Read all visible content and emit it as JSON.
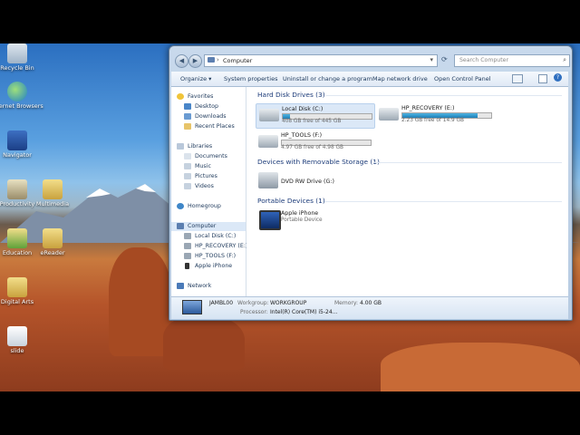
{
  "desktop": {
    "icons": [
      {
        "label": "Recycle Bin",
        "name": "recycle-bin"
      },
      {
        "label": "Internet Browsers",
        "name": "internet-browsers"
      },
      {
        "label": "Navigator",
        "name": "navigator"
      },
      {
        "label": "Productivity",
        "name": "productivity"
      },
      {
        "label": "Multimedia",
        "name": "multimedia"
      },
      {
        "label": "Education",
        "name": "education"
      },
      {
        "label": "eReader",
        "name": "ereader"
      },
      {
        "label": "Digital Arts",
        "name": "digital-arts"
      },
      {
        "label": "slide",
        "name": "slide"
      }
    ]
  },
  "explorer": {
    "address": "Computer",
    "search_placeholder": "Search Computer",
    "toolbar": {
      "organize": "Organize ▾",
      "system_properties": "System properties",
      "uninstall": "Uninstall or change a program",
      "map_drive": "Map network drive",
      "control_panel": "Open Control Panel"
    },
    "nav": {
      "favorites": "Favorites",
      "desktop": "Desktop",
      "downloads": "Downloads",
      "recent_places": "Recent Places",
      "libraries": "Libraries",
      "documents": "Documents",
      "music": "Music",
      "pictures": "Pictures",
      "videos": "Videos",
      "homegroup": "Homegroup",
      "computer": "Computer",
      "local_disk": "Local Disk (C:)",
      "hp_recovery": "HP_RECOVERY (E:)",
      "hp_tools": "HP_TOOLS (F:)",
      "apple_iphone": "Apple iPhone",
      "network": "Network"
    },
    "groups": {
      "hard_disk": "Hard Disk Drives (3)",
      "removable": "Devices with Removable Storage (1)",
      "portable": "Portable Devices (1)"
    },
    "drives": {
      "c": {
        "name": "Local Disk (C:)",
        "free": "408 GB free of 445 GB",
        "used_fraction": 0.083
      },
      "e": {
        "name": "HP_RECOVERY (E:)",
        "free": "2.23 GB free of 14.9 GB",
        "used_fraction": 0.85
      },
      "f": {
        "name": "HP_TOOLS (F:)",
        "free": "4.97 GB free of 4.98 GB",
        "used_fraction": 0.002
      }
    },
    "dvd": {
      "name": "DVD RW Drive (G:)"
    },
    "iphone": {
      "name": "Apple iPhone",
      "sub": "Portable Device"
    },
    "details": {
      "computer_name": "JAMBL00",
      "workgroup_label": "Workgroup:",
      "workgroup_value": "WORKGROUP",
      "memory_label": "Memory:",
      "memory_value": "4.00 GB",
      "processor_label": "Processor:",
      "processor_value": "Intel(R) Core(TM) i5-24..."
    }
  },
  "colors": {
    "accent": "#1d7fb7",
    "group_header": "#1e3d7a",
    "selection": "#dbe8f7"
  }
}
